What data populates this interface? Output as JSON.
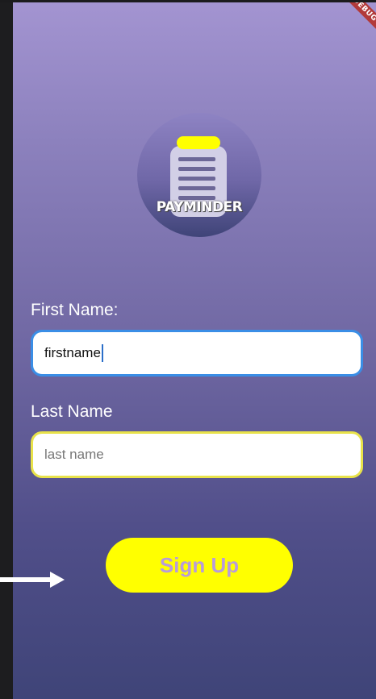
{
  "debug_banner": "DEBUG",
  "logo": {
    "text": "PAYMINDER",
    "icon": "clipboard-icon"
  },
  "form": {
    "first_name_label": "First Name:",
    "first_name_value": "firstname",
    "last_name_label": "Last Name",
    "last_name_placeholder": "last name",
    "signup_label": "Sign Up"
  },
  "colors": {
    "gradient_top": "#a394d1",
    "gradient_bottom": "#3f4478",
    "accent_yellow": "#ffff00",
    "focus_blue": "#3a8ee6",
    "signup_text": "#b89cd9"
  },
  "annotation": {
    "icon": "arrow-right-icon"
  }
}
